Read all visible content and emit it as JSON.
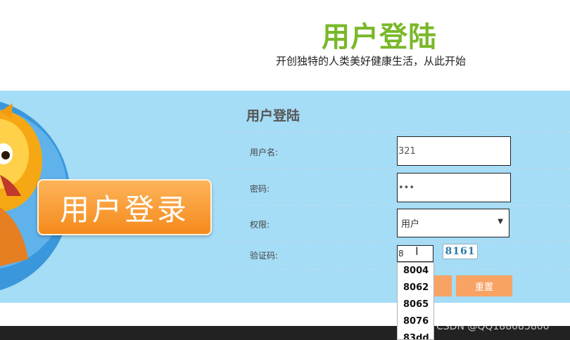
{
  "header": {
    "title": "用户登陆",
    "slogan": "开创独特的人类美好健康生活，从此开始"
  },
  "illustration": {
    "badge_text": "用户登录"
  },
  "form": {
    "title": "用户登陆",
    "username_label": "用户名:",
    "username_value": "321",
    "password_label": "密码:",
    "password_value": "•••",
    "role_label": "权限:",
    "role_value": "用户",
    "captcha_label": "验证码:",
    "captcha_value": "8",
    "captcha_code": "8161",
    "reset_label": "重置"
  },
  "autocomplete": {
    "items": [
      "8004",
      "8062",
      "8065",
      "8076",
      "83dd"
    ]
  },
  "watermark": "CSDN @QQ188083800",
  "colors": {
    "title_green": "#79b829",
    "band_blue": "#a5dcf6",
    "button_orange": "#f8a364",
    "badge_orange": "#f48a1c"
  }
}
